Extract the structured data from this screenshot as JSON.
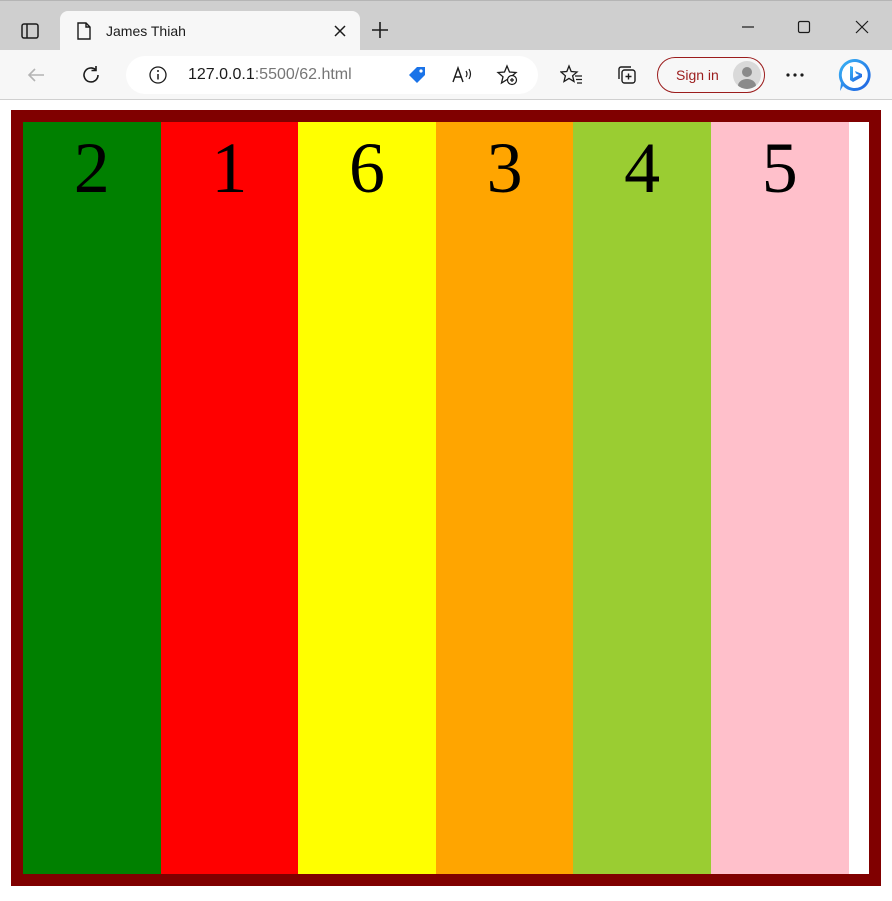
{
  "browser": {
    "tab": {
      "title": "James Thiah"
    },
    "address": {
      "host": "127.0.0.1",
      "rest": ":5500/62.html"
    },
    "signin_label": "Sign in"
  },
  "page": {
    "border_color": "#800000",
    "columns": [
      {
        "label": "2",
        "color": "green"
      },
      {
        "label": "1",
        "color": "red"
      },
      {
        "label": "6",
        "color": "yellow"
      },
      {
        "label": "3",
        "color": "orange"
      },
      {
        "label": "4",
        "color": "yellowgreen"
      },
      {
        "label": "5",
        "color": "pink"
      }
    ]
  }
}
